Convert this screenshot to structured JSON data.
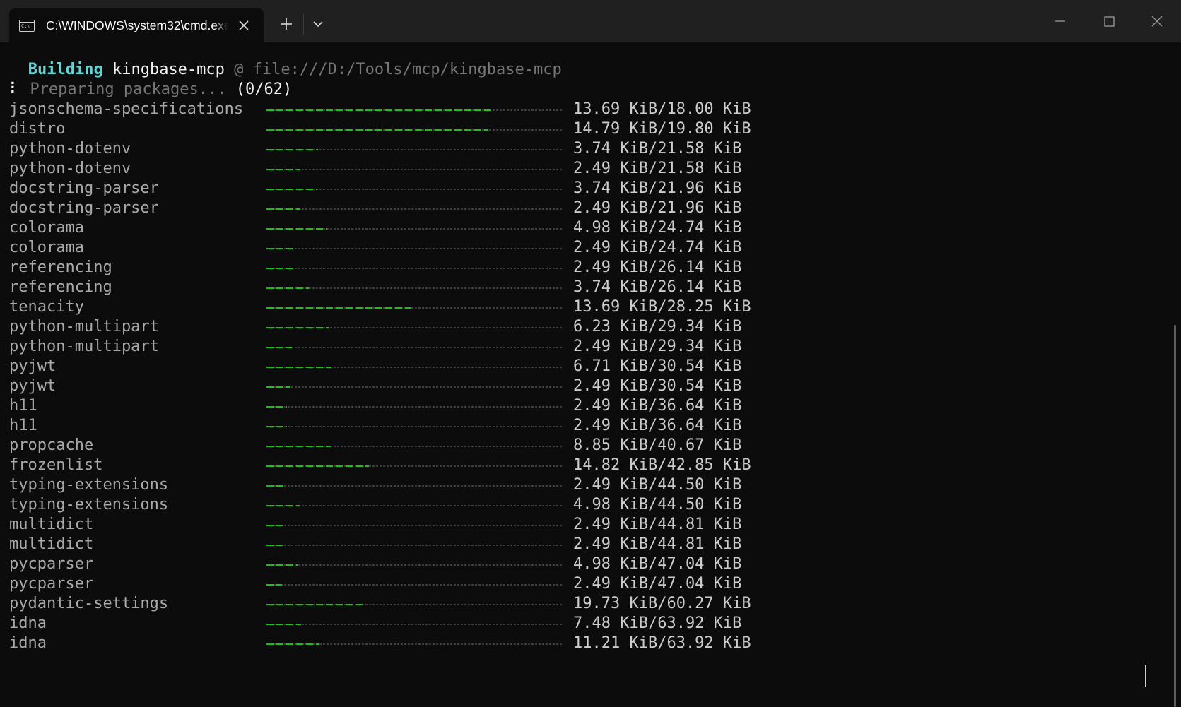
{
  "window": {
    "tab_title": "C:\\WINDOWS\\system32\\cmd.exe",
    "icons": {
      "tab_icon": "cmd-icon",
      "tab_close": "close-icon",
      "new_tab": "plus-icon",
      "dropdown": "chevron-down-icon",
      "minimize": "minimize-icon",
      "maximize": "maximize-icon",
      "close": "close-icon"
    }
  },
  "terminal": {
    "header": {
      "verb": "Building",
      "project": "kingbase-mcp",
      "at": "@",
      "path": "file:///D:/Tools/mcp/kingbase-mcp"
    },
    "status": {
      "spinner": "⠇",
      "text": "Preparing packages...",
      "count": "(0/62)"
    },
    "packages": [
      {
        "name": "jsonschema-specifications",
        "size": "13.69 KiB/18.00 KiB",
        "progress": 0.7606
      },
      {
        "name": "distro",
        "size": "14.79 KiB/19.80 KiB",
        "progress": 0.747
      },
      {
        "name": "python-dotenv",
        "size": "3.74 KiB/21.58 KiB",
        "progress": 0.1733
      },
      {
        "name": "python-dotenv",
        "size": "2.49 KiB/21.58 KiB",
        "progress": 0.1154
      },
      {
        "name": "docstring-parser",
        "size": "3.74 KiB/21.96 KiB",
        "progress": 0.1703
      },
      {
        "name": "docstring-parser",
        "size": "2.49 KiB/21.96 KiB",
        "progress": 0.1134
      },
      {
        "name": "colorama",
        "size": "4.98 KiB/24.74 KiB",
        "progress": 0.2013
      },
      {
        "name": "colorama",
        "size": "2.49 KiB/24.74 KiB",
        "progress": 0.1006
      },
      {
        "name": "referencing",
        "size": "2.49 KiB/26.14 KiB",
        "progress": 0.0953
      },
      {
        "name": "referencing",
        "size": "3.74 KiB/26.14 KiB",
        "progress": 0.1431
      },
      {
        "name": "tenacity",
        "size": "13.69 KiB/28.25 KiB",
        "progress": 0.4846
      },
      {
        "name": "python-multipart",
        "size": "6.23 KiB/29.34 KiB",
        "progress": 0.2123
      },
      {
        "name": "python-multipart",
        "size": "2.49 KiB/29.34 KiB",
        "progress": 0.0849
      },
      {
        "name": "pyjwt",
        "size": "6.71 KiB/30.54 KiB",
        "progress": 0.2197
      },
      {
        "name": "pyjwt",
        "size": "2.49 KiB/30.54 KiB",
        "progress": 0.0815
      },
      {
        "name": "h11",
        "size": "2.49 KiB/36.64 KiB",
        "progress": 0.068
      },
      {
        "name": "h11",
        "size": "2.49 KiB/36.64 KiB",
        "progress": 0.068
      },
      {
        "name": "propcache",
        "size": "8.85 KiB/40.67 KiB",
        "progress": 0.2176
      },
      {
        "name": "frozenlist",
        "size": "14.82 KiB/42.85 KiB",
        "progress": 0.3459
      },
      {
        "name": "typing-extensions",
        "size": "2.49 KiB/44.50 KiB",
        "progress": 0.056
      },
      {
        "name": "typing-extensions",
        "size": "4.98 KiB/44.50 KiB",
        "progress": 0.1119
      },
      {
        "name": "multidict",
        "size": "2.49 KiB/44.81 KiB",
        "progress": 0.0556
      },
      {
        "name": "multidict",
        "size": "2.49 KiB/44.81 KiB",
        "progress": 0.0556
      },
      {
        "name": "pycparser",
        "size": "4.98 KiB/47.04 KiB",
        "progress": 0.1059
      },
      {
        "name": "pycparser",
        "size": "2.49 KiB/47.04 KiB",
        "progress": 0.0529
      },
      {
        "name": "pydantic-settings",
        "size": "19.73 KiB/60.27 KiB",
        "progress": 0.3274
      },
      {
        "name": "idna",
        "size": "7.48 KiB/63.92 KiB",
        "progress": 0.117
      },
      {
        "name": "idna",
        "size": "11.21 KiB/63.92 KiB",
        "progress": 0.1754
      }
    ]
  },
  "colors": {
    "background": "#0c0c0c",
    "titlebar": "#202020",
    "cyan": "#61d6d6",
    "progress_fill": "#16c60c",
    "progress_track": "#3d3d3d",
    "text": "#cccccc",
    "package_name": "#a9a9a9"
  }
}
